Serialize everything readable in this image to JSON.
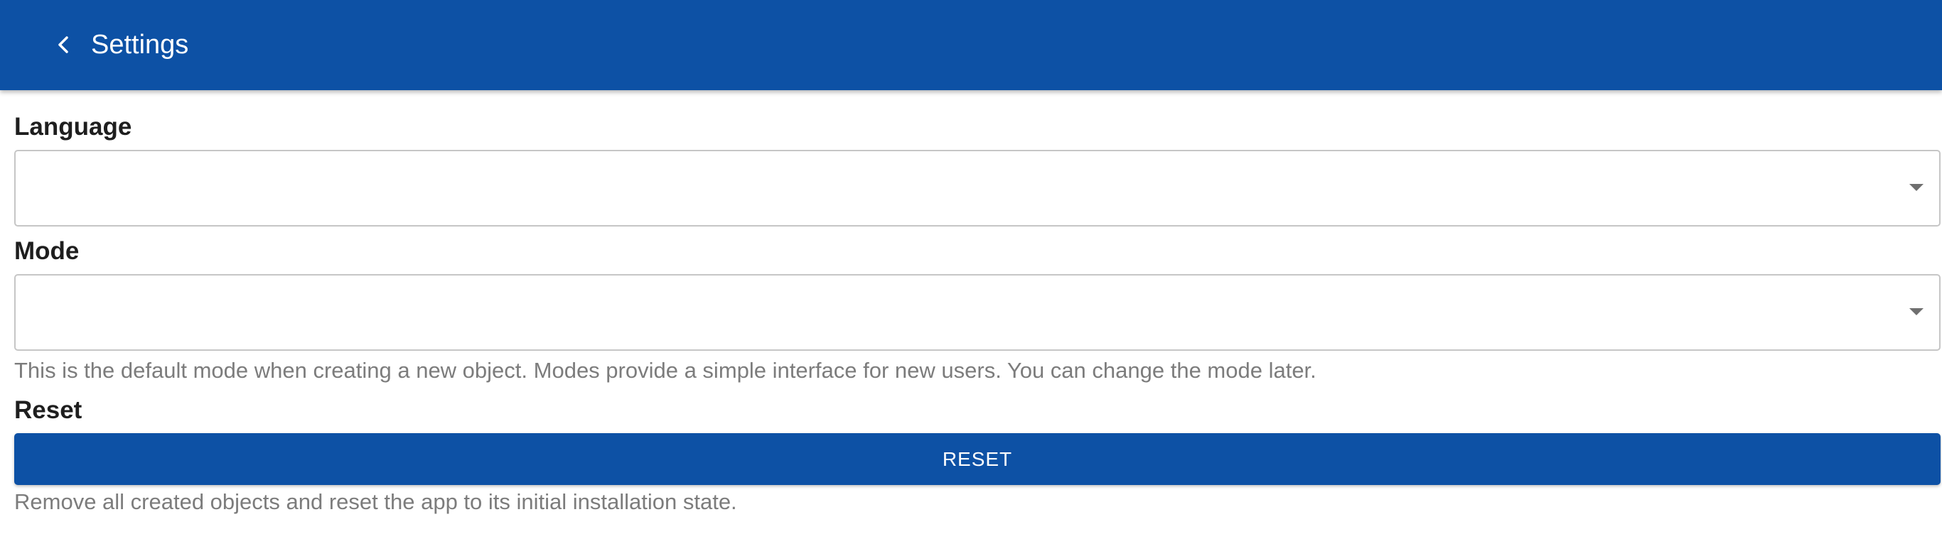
{
  "header": {
    "title": "Settings",
    "back_icon": "chevron-left-icon",
    "background_color": "#0d51a5"
  },
  "language": {
    "label": "Language",
    "value": "",
    "icon": "caret-down-icon"
  },
  "mode": {
    "label": "Mode",
    "value": "",
    "icon": "caret-down-icon",
    "help": "This is the default mode when creating a new object. Modes provide a simple interface for new users. You can change the mode later."
  },
  "reset": {
    "label": "Reset",
    "button_label": "RESET",
    "help": "Remove all created objects and reset the app to its initial installation state.",
    "button_color": "#0d51a5"
  }
}
